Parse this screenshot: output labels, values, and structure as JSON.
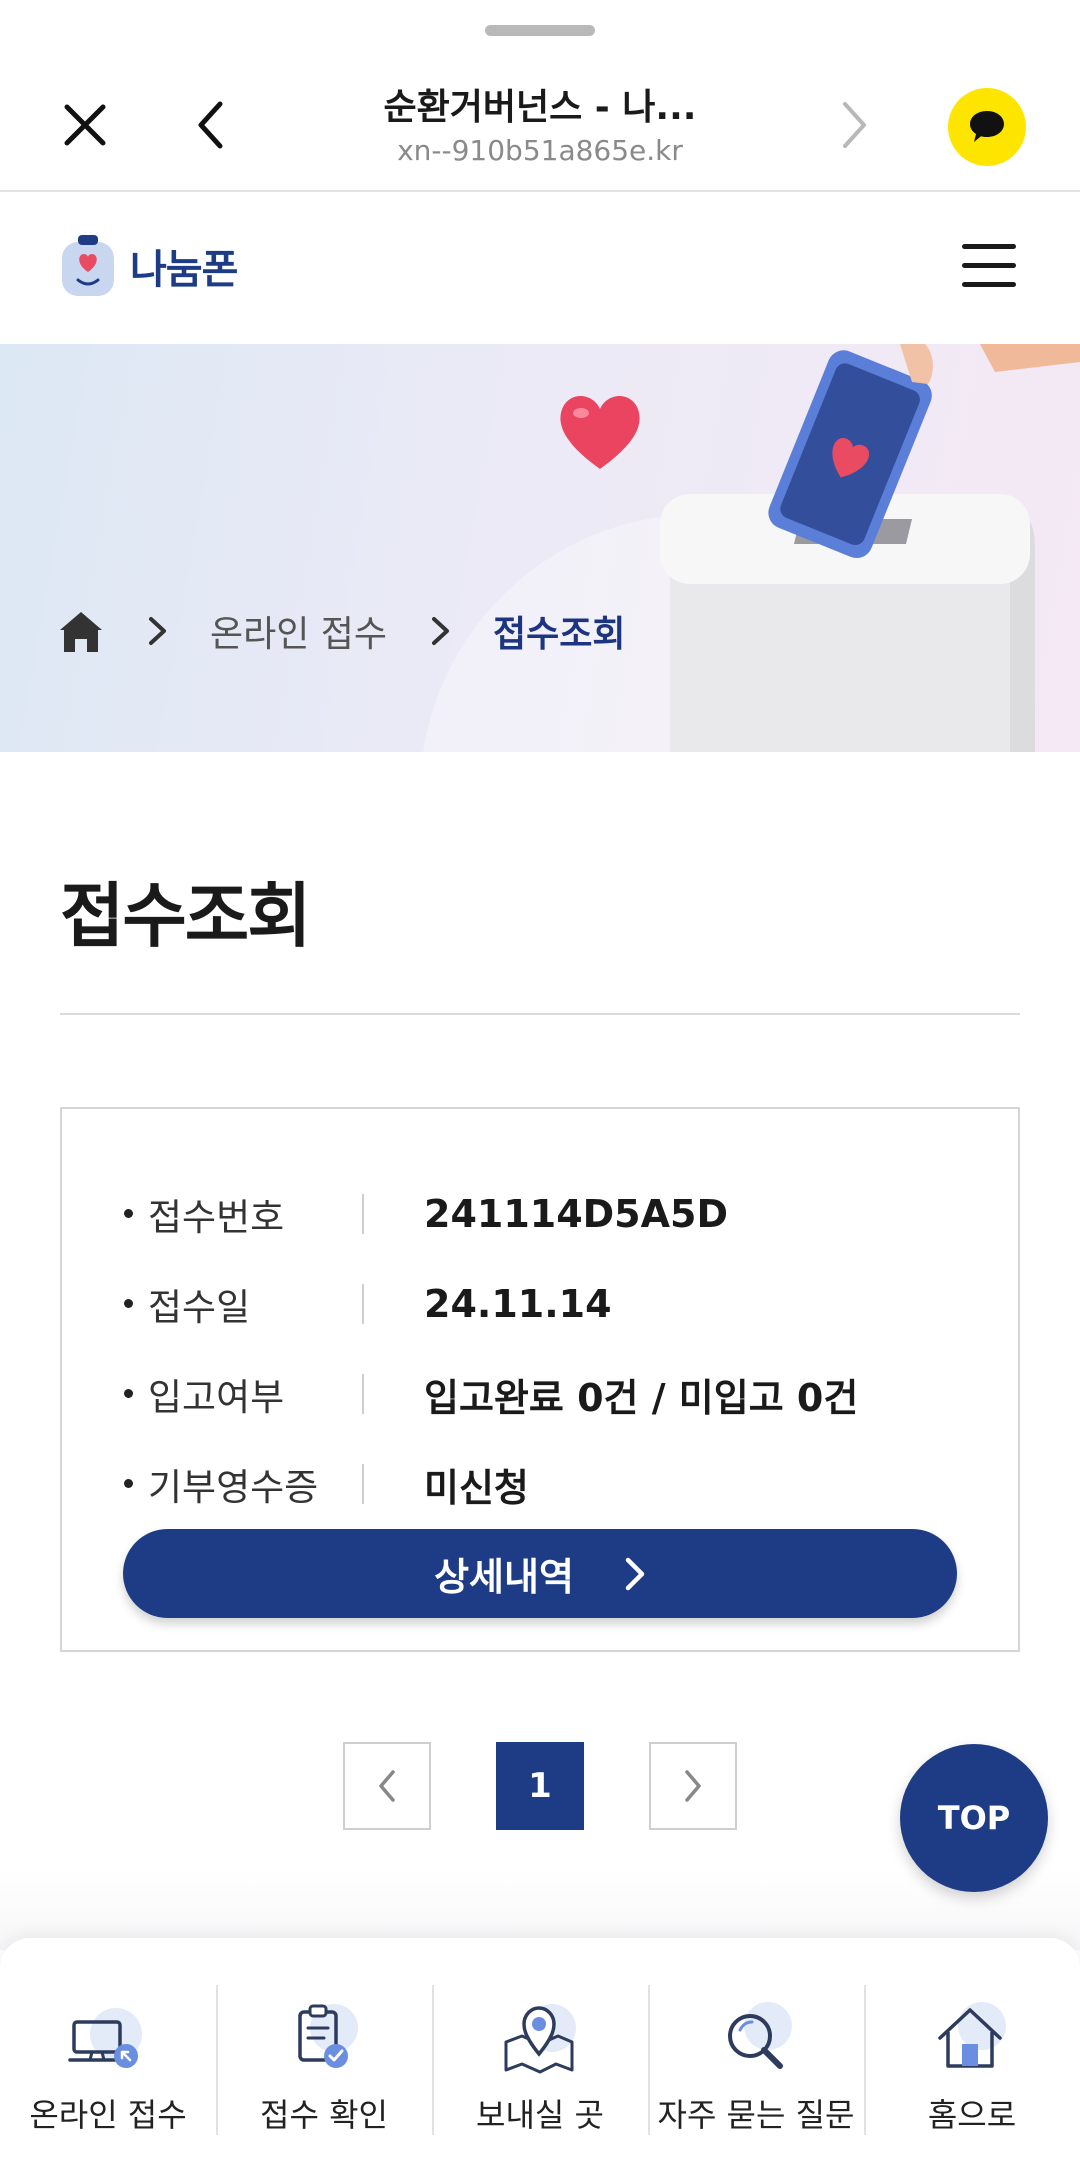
{
  "browser": {
    "title": "순환거버넌스 - 나...",
    "url": "xn--910b51a865e.kr"
  },
  "site": {
    "logo_text": "나눔폰"
  },
  "breadcrumb": {
    "parent": "온라인 접수",
    "current": "접수조회"
  },
  "page": {
    "title": "접수조회"
  },
  "receipt": {
    "rows": [
      {
        "label": "접수번호",
        "value": "241114D5A5D"
      },
      {
        "label": "접수일",
        "value": "24.11.14"
      },
      {
        "label": "입고여부",
        "value": "입고완료 0건 / 미입고 0건"
      },
      {
        "label": "기부영수증",
        "value": "미신청"
      }
    ],
    "detail_button": "상세내역"
  },
  "pagination": {
    "current_page": "1"
  },
  "top_button": "TOP",
  "bottom_nav": [
    {
      "label": "온라인 접수",
      "icon": "monitor-icon"
    },
    {
      "label": "접수 확인",
      "icon": "clipboard-check-icon"
    },
    {
      "label": "보내실 곳",
      "icon": "map-pin-icon"
    },
    {
      "label": "자주 묻는 질문",
      "icon": "search-icon"
    },
    {
      "label": "홈으로",
      "icon": "home-icon"
    }
  ],
  "colors": {
    "primary": "#1d3c85",
    "kakao_yellow": "#fee500",
    "accent_red": "#e94b62"
  }
}
